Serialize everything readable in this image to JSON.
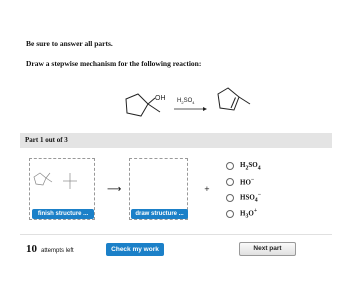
{
  "question": {
    "intro": "Be sure to answer all parts.",
    "prompt": "Draw a stepwise mechanism for the following reaction:"
  },
  "reaction": {
    "reactant_oh": "OH",
    "reagent": "H2SO4"
  },
  "part": {
    "label": "Part 1 out of 3"
  },
  "workspace": {
    "finish_button": "finish structure ...",
    "draw_button": "draw structure ...",
    "arrow": "⟶",
    "plus": "+"
  },
  "options": [
    {
      "base": "H",
      "sub": "2",
      "tail": "SO",
      "sub2": "4",
      "sup": ""
    },
    {
      "base": "HO",
      "sub": "",
      "tail": "",
      "sub2": "",
      "sup": "−"
    },
    {
      "base": "HSO",
      "sub": "4",
      "tail": "",
      "sub2": "",
      "sup": "−"
    },
    {
      "base": "H",
      "sub": "3",
      "tail": "O",
      "sub2": "",
      "sup": "+"
    }
  ],
  "footer": {
    "attempts_count": "10",
    "attempts_text": "attempts left",
    "check_button": "Check my work",
    "next_button": "Next part"
  },
  "colors": {
    "accent": "#1b80c8",
    "part_bar": "#e4e4e4"
  }
}
